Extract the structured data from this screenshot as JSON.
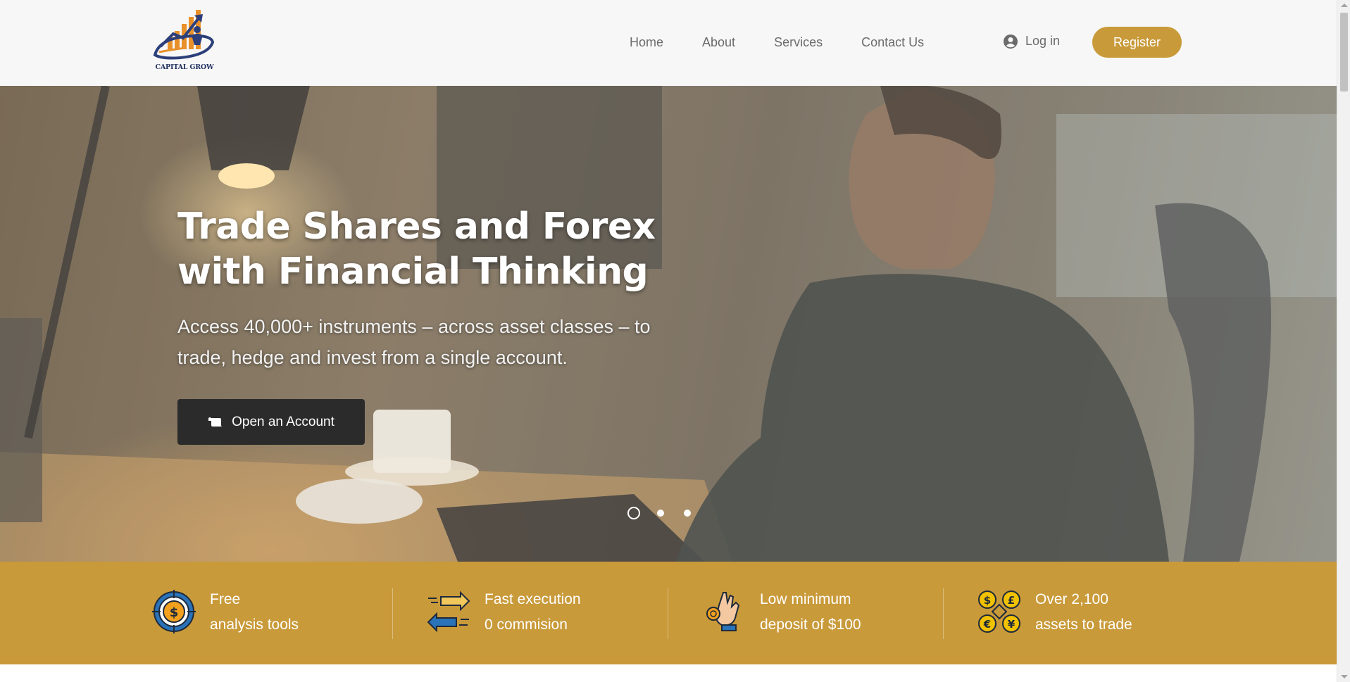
{
  "brand": {
    "logo_text": "CAPITAL GROW"
  },
  "nav": {
    "items": [
      {
        "label": "Home"
      },
      {
        "label": "About"
      },
      {
        "label": "Services"
      },
      {
        "label": "Contact Us"
      }
    ],
    "login_label": "Log in",
    "register_label": "Register"
  },
  "hero": {
    "title_line1": "Trade Shares and Forex",
    "title_line2": "with Financial Thinking",
    "subtitle_line1": "Access 40,000+ instruments – across asset classes – to",
    "subtitle_line2": "trade, hedge and invest from a single account.",
    "cta_label": "Open an Account",
    "slides_count": 3,
    "active_slide": 1
  },
  "features": [
    {
      "icon": "target-dollar-icon",
      "line1": "Free",
      "line2": "analysis tools"
    },
    {
      "icon": "arrows-exchange-icon",
      "line1": "Fast execution",
      "line2": "0 commision"
    },
    {
      "icon": "hand-coin-icon",
      "line1": "Low minimum",
      "line2": "deposit of $100"
    },
    {
      "icon": "currencies-icon",
      "line1": "Over 2,100",
      "line2": "assets to trade"
    }
  ],
  "colors": {
    "accent": "#c99a3a",
    "header_bg": "#f7f7f7",
    "cta_bg": "#2b2b2b",
    "nav_text": "#6b6b6b"
  }
}
